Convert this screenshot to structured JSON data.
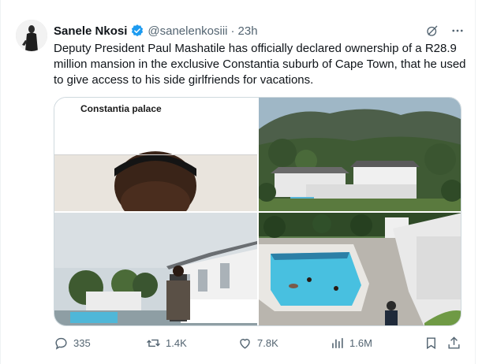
{
  "tweet": {
    "author_name": "Sanele Nkosi",
    "handle": "@sanelenkosiii",
    "separator": "·",
    "time": "23h",
    "text": "Deputy President Paul Mashatile has officially declared ownership of a R28.9 million mansion in the exclusive Constantia suburb of Cape Town, that he used to give access to his side girlfriends for vacations.",
    "verified": true
  },
  "media": {
    "image1_caption": "Constantia palace",
    "images": [
      "news-graphic-with-portrait",
      "hillside-mansion-aerial",
      "mansion-with-pool-and-person",
      "pool-with-swimmers"
    ]
  },
  "actions": {
    "replies": "335",
    "reposts": "1.4K",
    "likes": "7.8K",
    "views": "1.6M"
  },
  "icons": {
    "verified": "verified-badge-icon",
    "grok": "grok-icon",
    "more": "more-icon",
    "reply": "reply-icon",
    "repost": "repost-icon",
    "like": "like-icon",
    "views": "views-icon",
    "bookmark": "bookmark-icon",
    "share": "share-icon"
  },
  "colors": {
    "verified_blue": "#1d9bf0",
    "text_primary": "#0f1419",
    "text_secondary": "#536471"
  }
}
